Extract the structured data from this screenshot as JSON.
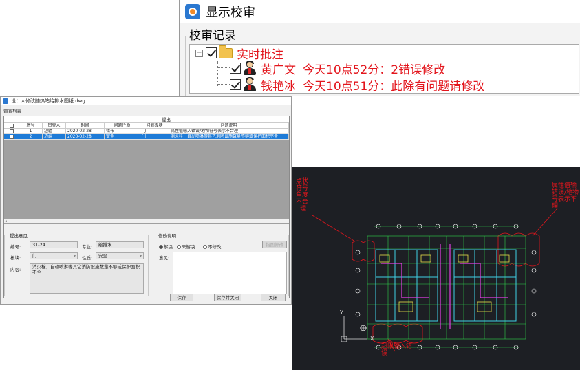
{
  "review_window": {
    "title": "显示校审",
    "group_label": "校审记录",
    "tree": {
      "root": {
        "label": "实时批注",
        "checked": true
      },
      "items": [
        {
          "reviewer": "黄广文",
          "comment": "今天10点52分：2错误修改",
          "checked": true
        },
        {
          "reviewer": "钱艳冰",
          "comment": "今天10点51分：此除有问题请修改",
          "checked": true
        }
      ]
    }
  },
  "dialog": {
    "title": "设计人修改随热站给排水图纸.dwg",
    "list_title": "审查列表",
    "merged_header": "提出",
    "columns": [
      "",
      "序号",
      "审查人",
      "时间",
      "问题性质",
      "问题板块",
      "问题说明"
    ],
    "rows": [
      {
        "index": "1",
        "reviewer": "边疆",
        "date": "2020-02-28",
        "nature": "错布",
        "block": "门",
        "desc": "属性值输入错误/地物符号表示不合理",
        "selected": false
      },
      {
        "index": "2",
        "reviewer": "边疆",
        "date": "2020-02-28",
        "nature": "安全",
        "block": "门",
        "desc": "消火栓，自动喷淋等其它消防设施数量不够或保护面积不全",
        "selected": true
      }
    ],
    "raise_section": {
      "legend": "提出意见",
      "number_label": "编号:",
      "number_value": "31-24",
      "major_label": "专业:",
      "major_value": "给排水",
      "block_label": "板块:",
      "block_value": "门",
      "nature_label": "性质:",
      "nature_value": "安全",
      "content_label": "内容:",
      "content_value": "消火栓，自动喷淋等其它消防设施数量不够或保护面积不全"
    },
    "modify_section": {
      "legend": "修改说明",
      "options": [
        "解决",
        "未解决",
        "不修改"
      ],
      "selected_option": "解决",
      "opinion_label": "意见:",
      "aux_button": "指图修改"
    },
    "buttons": {
      "save": "保存",
      "save_close": "保存并关闭",
      "close": "关闭"
    }
  },
  "cad": {
    "notes": {
      "left": [
        "点状",
        "符号",
        "角度",
        "不合",
        "理"
      ],
      "right": [
        "属性值输",
        "错误/地物",
        "号表示不",
        "理"
      ],
      "bottom": [
        "超限输入错",
        "误"
      ]
    },
    "colors": {
      "background": "#1d1f24",
      "annotation": "#e3161d",
      "axis": "#2fd44a"
    }
  }
}
